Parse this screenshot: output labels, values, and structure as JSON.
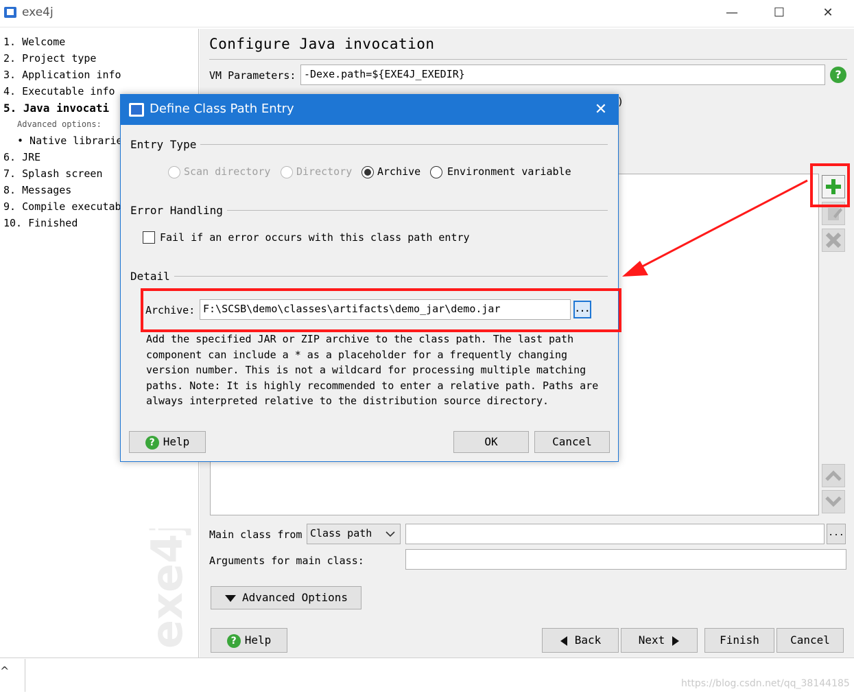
{
  "window": {
    "title": "exe4j",
    "minimize": "—",
    "maximize": "☐",
    "close": "✕"
  },
  "steps": [
    {
      "label": "1.  Welcome"
    },
    {
      "label": "2.  Project type"
    },
    {
      "label": "3.  Application info"
    },
    {
      "label": "4.  Executable info"
    },
    {
      "label": "5.  Java invocati"
    },
    {
      "label": "Advanced options:"
    },
    {
      "label": "• Native librarie"
    },
    {
      "label": "6.  JRE"
    },
    {
      "label": "7.  Splash screen"
    },
    {
      "label": "8.  Messages"
    },
    {
      "label": "9.  Compile executab"
    },
    {
      "label": "10.  Finished"
    }
  ],
  "watermark": "exe4j",
  "main": {
    "title": "Configure Java invocation",
    "vm_label": "VM Parameters:",
    "vm_value": "-Dexe.path=${EXE4J_EXEDIR}",
    "help_icon": "?",
    "partial_paren": ")",
    "main_class_label": "Main class from",
    "main_class_select": "Class path",
    "main_class_value": "",
    "browse_label": "...",
    "args_label": "Arguments for main class:",
    "args_value": "",
    "advanced_label": "Advanced Options",
    "help_label": "Help",
    "back_label": "Back",
    "next_label": "Next",
    "finish_label": "Finish",
    "cancel_label": "Cancel"
  },
  "dialog": {
    "title": "Define Class Path Entry",
    "close": "✕",
    "entry_type_heading": "Entry Type",
    "radios": [
      {
        "label": "Scan directory",
        "enabled": false,
        "checked": false
      },
      {
        "label": "Directory",
        "enabled": false,
        "checked": false
      },
      {
        "label": "Archive",
        "enabled": true,
        "checked": true
      },
      {
        "label": "Environment variable",
        "enabled": true,
        "checked": false
      }
    ],
    "error_heading": "Error Handling",
    "fail_label": "Fail if an error occurs with this class path entry",
    "detail_heading": "Detail",
    "archive_label": "Archive:",
    "archive_value": "F:\\SCSB\\demo\\classes\\artifacts\\demo_jar\\demo.jar",
    "browse_label": "...",
    "description": "Add the specified JAR or ZIP archive to the class path. The last path component can include a * as a placeholder for a frequently changing version number. This is not a wildcard for processing multiple matching paths. Note: It is highly recommended to enter a relative path. Paths are always interpreted relative to the distribution source directory.",
    "help_label": "Help",
    "ok_label": "OK",
    "cancel_label": "Cancel"
  },
  "footer": {
    "chevron": "^",
    "watermark_url": "https://blog.csdn.net/qq_38144185"
  },
  "colors": {
    "accent": "#1e76d4",
    "annotation": "#ff1a1a",
    "help_green": "#3aa63a"
  }
}
